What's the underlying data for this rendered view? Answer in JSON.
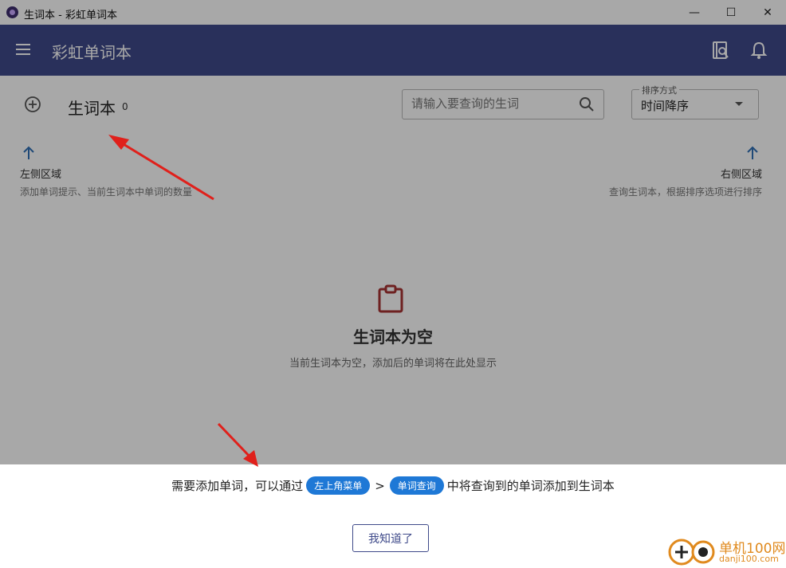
{
  "window": {
    "title": "生词本 - 彩虹单词本",
    "min_glyph": "—",
    "max_glyph": "☐",
    "close_glyph": "✕"
  },
  "appbar": {
    "title": "彩虹单词本"
  },
  "page": {
    "title": "生词本",
    "count": "0"
  },
  "search": {
    "placeholder": "请输入要查询的生词"
  },
  "sort": {
    "legend": "排序方式",
    "value": "时间降序"
  },
  "hints": {
    "left": {
      "title": "左侧区域",
      "desc": "添加单词提示、当前生词本中单词的数量"
    },
    "right": {
      "title": "右侧区域",
      "desc": "查询生词本，根据排序选项进行排序"
    }
  },
  "empty": {
    "title": "生词本为空",
    "desc": "当前生词本为空，添加后的单词将在此处显示"
  },
  "tip": {
    "before": "需要添加单词，可以通过",
    "chip1": "左上角菜单",
    "sep": ">",
    "chip2": "单词查询",
    "after": "中将查询到的单词添加到生词本",
    "button": "我知道了"
  },
  "watermark": {
    "text": "单机100网",
    "sub": "danji100.com"
  },
  "colors": {
    "appbar": "#3f4a8a",
    "chip": "#1e78d6",
    "annotation_arrow": "#e0201b",
    "hint_arrow": "#2f6fb5",
    "empty_icon": "#a83232"
  }
}
